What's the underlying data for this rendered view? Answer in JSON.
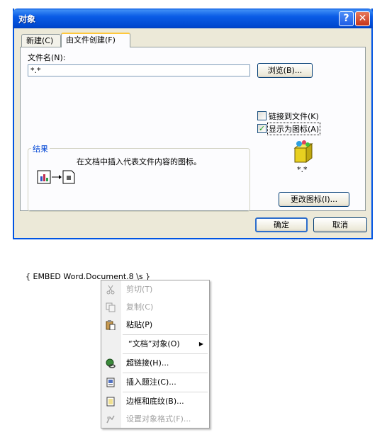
{
  "dialog": {
    "title": "对象",
    "help_glyph": "?",
    "close_glyph": "✕",
    "tabs": [
      {
        "label": "新建(C)"
      },
      {
        "label": "由文件创建(F)"
      }
    ],
    "filename_label": "文件名(N):",
    "filename_value": "*.*",
    "browse_label": "浏览(B)...",
    "link_label": "链接到文件(K)",
    "link_checked": false,
    "show_icon_label": "显示为图标(A)",
    "show_icon_checked": true,
    "result_title": "结果",
    "result_text": "在文档中插入代表文件内容的图标。",
    "icon_caption": "*.*",
    "change_icon_label": "更改图标(I)...",
    "ok_label": "确定",
    "cancel_label": "取消"
  },
  "document": {
    "field_code": "{ EMBED Word.Document.8 \\s }"
  },
  "context_menu": {
    "items": [
      {
        "label": "剪切(T)",
        "icon": "scissors-icon",
        "disabled": true
      },
      {
        "label": "复制(C)",
        "icon": "copy-icon",
        "disabled": true
      },
      {
        "label": "粘贴(P)",
        "icon": "paste-icon",
        "disabled": false
      },
      {
        "label": "“文档”对象(O)",
        "icon": "",
        "disabled": false,
        "submenu": true
      },
      {
        "label": "超链接(H)...",
        "icon": "hyperlink-icon",
        "disabled": false
      },
      {
        "label": "插入题注(C)...",
        "icon": "caption-icon",
        "disabled": false
      },
      {
        "label": "边框和底纹(B)...",
        "icon": "borders-icon",
        "disabled": false
      },
      {
        "label": "设置对象格式(F)...",
        "icon": "format-object-icon",
        "disabled": true
      }
    ]
  }
}
